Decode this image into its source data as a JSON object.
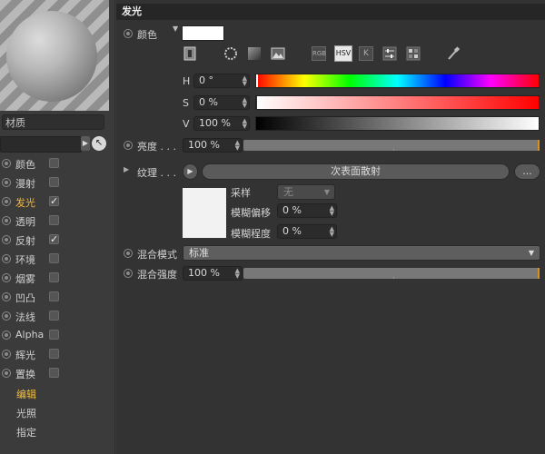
{
  "left_panel": {
    "material_name": "材质",
    "channels": [
      {
        "label": "颜色",
        "checked": false,
        "active": false
      },
      {
        "label": "漫射",
        "checked": false,
        "active": false
      },
      {
        "label": "发光",
        "checked": true,
        "active": true
      },
      {
        "label": "透明",
        "checked": false,
        "active": false
      },
      {
        "label": "反射",
        "checked": true,
        "active": false
      },
      {
        "label": "环境",
        "checked": false,
        "active": false
      },
      {
        "label": "烟雾",
        "checked": false,
        "active": false
      },
      {
        "label": "凹凸",
        "checked": false,
        "active": false
      },
      {
        "label": "法线",
        "checked": false,
        "active": false
      },
      {
        "label": "Alpha",
        "checked": false,
        "active": false
      },
      {
        "label": "辉光",
        "checked": false,
        "active": false
      },
      {
        "label": "置换",
        "checked": false,
        "active": false
      }
    ],
    "sub_items": [
      "编辑",
      "光照",
      "指定"
    ]
  },
  "panel": {
    "title": "发光",
    "color": {
      "label": "颜色",
      "swatch": "#ffffff"
    },
    "color_modes": [
      "RGB",
      "HSV",
      "K"
    ],
    "hsv": {
      "h_label": "H",
      "h_value": "0 °",
      "s_label": "S",
      "s_value": "0 %",
      "v_label": "V",
      "v_value": "100 %"
    },
    "brightness": {
      "label": "亮度 . . .",
      "value": "100 %"
    },
    "texture": {
      "label": "纹理 . . .",
      "shader_name": "次表面散射",
      "more_button": "...",
      "sampling_label": "采样",
      "sampling_value": "无",
      "blur_offset_label": "模糊偏移",
      "blur_offset_value": "0 %",
      "blur_scale_label": "模糊程度",
      "blur_scale_value": "0 %"
    },
    "mix_mode": {
      "label": "混合模式",
      "value": "标准"
    },
    "mix_strength": {
      "label": "混合强度",
      "value": "100 %"
    }
  },
  "colors": {
    "accent": "#f0b640",
    "panel_bg": "#333333",
    "header_bg": "#262626"
  }
}
